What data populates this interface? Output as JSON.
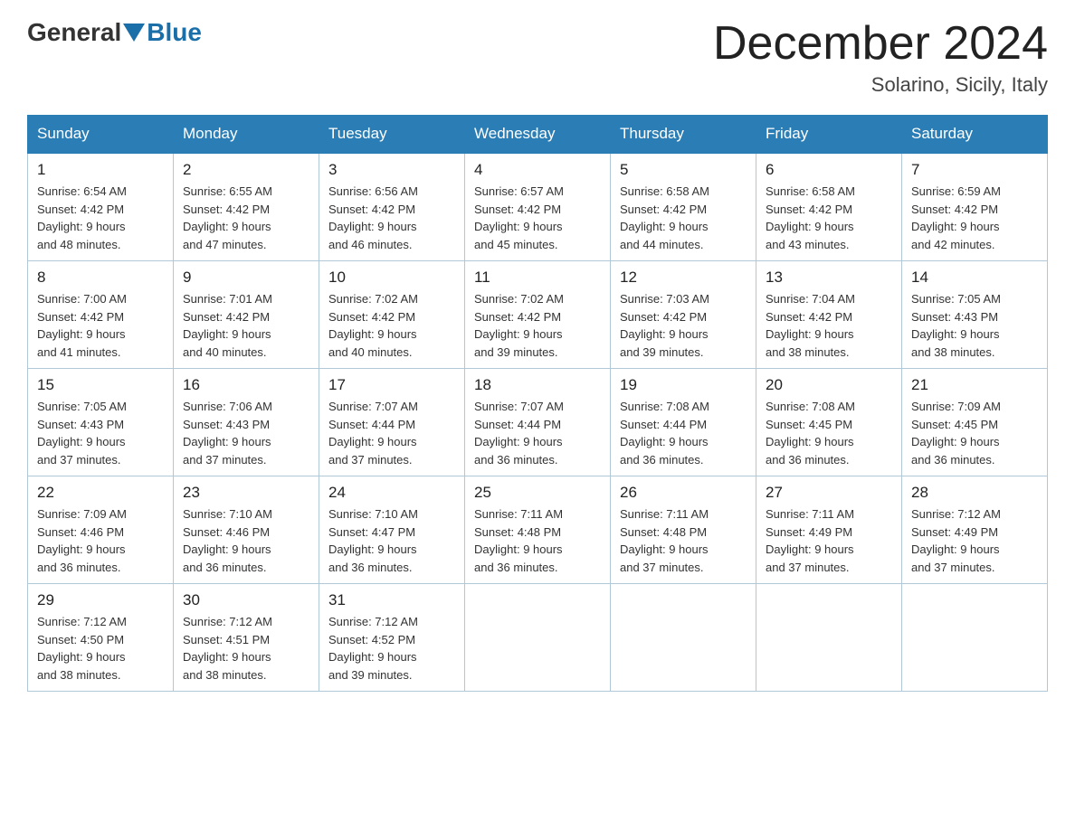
{
  "header": {
    "logo_general": "General",
    "logo_blue": "Blue",
    "month_title": "December 2024",
    "location": "Solarino, Sicily, Italy"
  },
  "days_of_week": [
    "Sunday",
    "Monday",
    "Tuesday",
    "Wednesday",
    "Thursday",
    "Friday",
    "Saturday"
  ],
  "weeks": [
    [
      {
        "day": "1",
        "sunrise": "6:54 AM",
        "sunset": "4:42 PM",
        "daylight": "9 hours and 48 minutes."
      },
      {
        "day": "2",
        "sunrise": "6:55 AM",
        "sunset": "4:42 PM",
        "daylight": "9 hours and 47 minutes."
      },
      {
        "day": "3",
        "sunrise": "6:56 AM",
        "sunset": "4:42 PM",
        "daylight": "9 hours and 46 minutes."
      },
      {
        "day": "4",
        "sunrise": "6:57 AM",
        "sunset": "4:42 PM",
        "daylight": "9 hours and 45 minutes."
      },
      {
        "day": "5",
        "sunrise": "6:58 AM",
        "sunset": "4:42 PM",
        "daylight": "9 hours and 44 minutes."
      },
      {
        "day": "6",
        "sunrise": "6:58 AM",
        "sunset": "4:42 PM",
        "daylight": "9 hours and 43 minutes."
      },
      {
        "day": "7",
        "sunrise": "6:59 AM",
        "sunset": "4:42 PM",
        "daylight": "9 hours and 42 minutes."
      }
    ],
    [
      {
        "day": "8",
        "sunrise": "7:00 AM",
        "sunset": "4:42 PM",
        "daylight": "9 hours and 41 minutes."
      },
      {
        "day": "9",
        "sunrise": "7:01 AM",
        "sunset": "4:42 PM",
        "daylight": "9 hours and 40 minutes."
      },
      {
        "day": "10",
        "sunrise": "7:02 AM",
        "sunset": "4:42 PM",
        "daylight": "9 hours and 40 minutes."
      },
      {
        "day": "11",
        "sunrise": "7:02 AM",
        "sunset": "4:42 PM",
        "daylight": "9 hours and 39 minutes."
      },
      {
        "day": "12",
        "sunrise": "7:03 AM",
        "sunset": "4:42 PM",
        "daylight": "9 hours and 39 minutes."
      },
      {
        "day": "13",
        "sunrise": "7:04 AM",
        "sunset": "4:42 PM",
        "daylight": "9 hours and 38 minutes."
      },
      {
        "day": "14",
        "sunrise": "7:05 AM",
        "sunset": "4:43 PM",
        "daylight": "9 hours and 38 minutes."
      }
    ],
    [
      {
        "day": "15",
        "sunrise": "7:05 AM",
        "sunset": "4:43 PM",
        "daylight": "9 hours and 37 minutes."
      },
      {
        "day": "16",
        "sunrise": "7:06 AM",
        "sunset": "4:43 PM",
        "daylight": "9 hours and 37 minutes."
      },
      {
        "day": "17",
        "sunrise": "7:07 AM",
        "sunset": "4:44 PM",
        "daylight": "9 hours and 37 minutes."
      },
      {
        "day": "18",
        "sunrise": "7:07 AM",
        "sunset": "4:44 PM",
        "daylight": "9 hours and 36 minutes."
      },
      {
        "day": "19",
        "sunrise": "7:08 AM",
        "sunset": "4:44 PM",
        "daylight": "9 hours and 36 minutes."
      },
      {
        "day": "20",
        "sunrise": "7:08 AM",
        "sunset": "4:45 PM",
        "daylight": "9 hours and 36 minutes."
      },
      {
        "day": "21",
        "sunrise": "7:09 AM",
        "sunset": "4:45 PM",
        "daylight": "9 hours and 36 minutes."
      }
    ],
    [
      {
        "day": "22",
        "sunrise": "7:09 AM",
        "sunset": "4:46 PM",
        "daylight": "9 hours and 36 minutes."
      },
      {
        "day": "23",
        "sunrise": "7:10 AM",
        "sunset": "4:46 PM",
        "daylight": "9 hours and 36 minutes."
      },
      {
        "day": "24",
        "sunrise": "7:10 AM",
        "sunset": "4:47 PM",
        "daylight": "9 hours and 36 minutes."
      },
      {
        "day": "25",
        "sunrise": "7:11 AM",
        "sunset": "4:48 PM",
        "daylight": "9 hours and 36 minutes."
      },
      {
        "day": "26",
        "sunrise": "7:11 AM",
        "sunset": "4:48 PM",
        "daylight": "9 hours and 37 minutes."
      },
      {
        "day": "27",
        "sunrise": "7:11 AM",
        "sunset": "4:49 PM",
        "daylight": "9 hours and 37 minutes."
      },
      {
        "day": "28",
        "sunrise": "7:12 AM",
        "sunset": "4:49 PM",
        "daylight": "9 hours and 37 minutes."
      }
    ],
    [
      {
        "day": "29",
        "sunrise": "7:12 AM",
        "sunset": "4:50 PM",
        "daylight": "9 hours and 38 minutes."
      },
      {
        "day": "30",
        "sunrise": "7:12 AM",
        "sunset": "4:51 PM",
        "daylight": "9 hours and 38 minutes."
      },
      {
        "day": "31",
        "sunrise": "7:12 AM",
        "sunset": "4:52 PM",
        "daylight": "9 hours and 39 minutes."
      },
      null,
      null,
      null,
      null
    ]
  ],
  "labels": {
    "sunrise": "Sunrise:",
    "sunset": "Sunset:",
    "daylight": "Daylight:"
  }
}
